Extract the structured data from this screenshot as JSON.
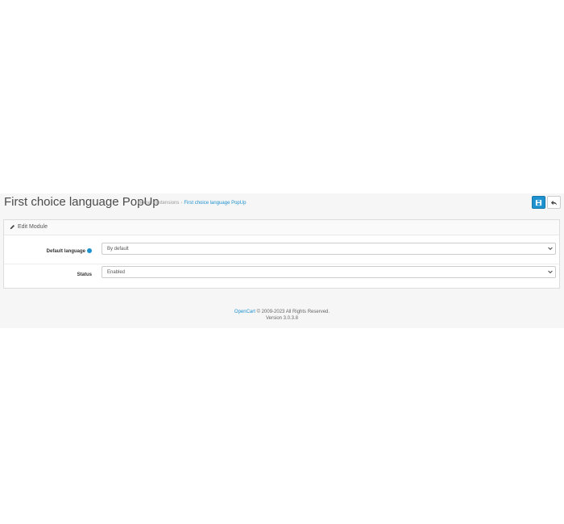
{
  "header": {
    "title": "First choice language PopUp",
    "breadcrumbs": [
      "Home",
      "Extensions",
      "First choice language PopUp"
    ],
    "separator": "›",
    "save_icon": "save-icon",
    "back_icon": "reply-icon"
  },
  "panel": {
    "icon": "pencil-icon",
    "title": "Edit Module",
    "fields": [
      {
        "label": "Default language",
        "value": "By default",
        "help_icon": "info-icon"
      },
      {
        "label": "Status",
        "value": "Enabled"
      }
    ]
  },
  "footer": {
    "brand": "OpenCart",
    "copyright": "© 2009-2023 All Rights Reserved.",
    "version": "Version 3.0.3.8"
  },
  "colors": {
    "accent": "#1e91cf",
    "page_bg": "#f6f6f6"
  }
}
